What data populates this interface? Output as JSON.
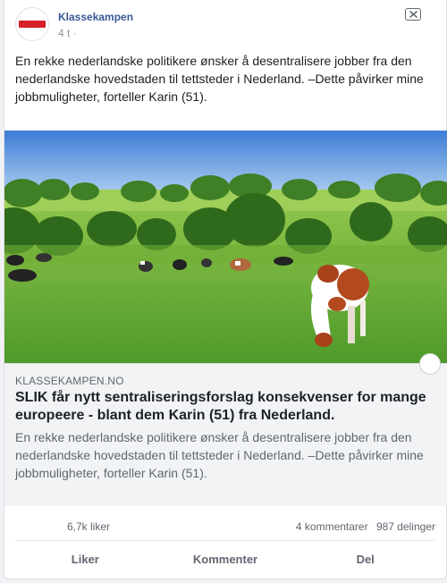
{
  "post": {
    "page_name": "Klassekampen",
    "timestamp": "4 t ·",
    "text": "En rekke nederlandske politikere ønsker å desentralisere jobber fra den nederlandske hovedstaden til tettsteder i Nederland. –Dette påvirker mine jobbmuligheter, forteller Karin (51).",
    "avatar_icon": "klassekampen-logo",
    "brand_color": "#d61f26",
    "name_color": "#385898"
  },
  "link": {
    "domain": "KLASSEKAMPEN.NO",
    "title": "SLIK får nytt sentraliseringsforslag konsekvenser for mange europeere - blant dem Karin (51) fra Nederland.",
    "description": "En rekke nederlandske politikere ønsker å desentralisere jobber fra den nederlandske hovedstaden til tettsteder i Nederland. –Dette påvirker mine jobbmuligheter, forteller Karin (51)."
  },
  "stats": {
    "likes": "6,7k liker",
    "comments": "4 kommentarer",
    "shares": "987 delinger"
  },
  "actions": {
    "like": "Liker",
    "comment": "Kommenter",
    "share": "Del"
  }
}
